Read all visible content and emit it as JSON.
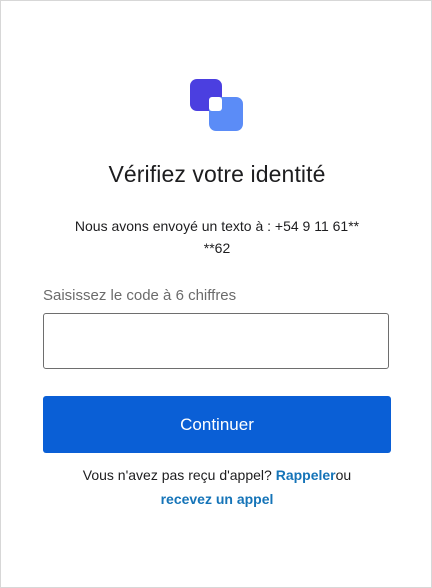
{
  "title": "Vérifiez votre identité",
  "subtitle": {
    "line1": "Nous avons envoyé un texto à : +54 9 11 61**",
    "line2": "**62"
  },
  "code_field": {
    "label": "Saisissez le code à 6 chiffres",
    "value": "",
    "placeholder": ""
  },
  "continue_button": {
    "label": "Continuer"
  },
  "footer": {
    "prompt": "Vous n'avez pas reçu d'appel?",
    "call_back_link": "Rappeler",
    "or_text": "ou",
    "receive_call_link": "recevez un appel"
  },
  "colors": {
    "accent": "#0a5fd6",
    "link": "#1574b8",
    "logo_dark": "#4b3fe0",
    "logo_light": "#5b8cf7"
  },
  "icons": {
    "logo": "overlapping-squares-logo"
  }
}
